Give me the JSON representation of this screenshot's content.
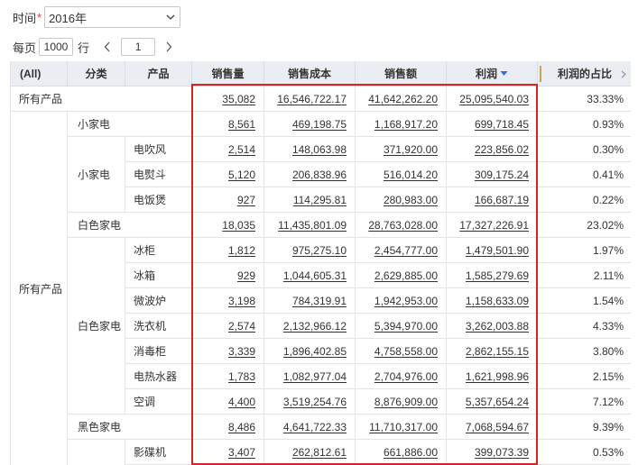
{
  "filter": {
    "label": "时间",
    "required_mark": "*",
    "value": "2016年"
  },
  "pager": {
    "per_page_label": "每页",
    "per_page_value": "1000",
    "per_page_unit": "行",
    "page": "1"
  },
  "columns": {
    "all": "(All)",
    "category": "分类",
    "product": "产品",
    "sales_qty": "销售量",
    "sales_cost": "销售成本",
    "sales_amount": "销售额",
    "profit": "利润",
    "profit_share": "利润的占比"
  },
  "groups": {
    "all_products": "所有产品",
    "small_appliances": "小家电",
    "white_appliances": "白色家电",
    "black_appliances": "黑色家电"
  },
  "rows": [
    {
      "label": "所有产品",
      "qty": "35,082",
      "cost": "16,546,722.17",
      "amount": "41,642,262.20",
      "profit": "25,095,540.03",
      "share": "33.33%"
    },
    {
      "label": "小家电",
      "qty": "8,561",
      "cost": "469,198.75",
      "amount": "1,168,917.20",
      "profit": "699,718.45",
      "share": "0.93%"
    },
    {
      "label": "电吹风",
      "qty": "2,514",
      "cost": "148,063.98",
      "amount": "371,920.00",
      "profit": "223,856.02",
      "share": "0.30%"
    },
    {
      "label": "电熨斗",
      "qty": "5,120",
      "cost": "206,838.96",
      "amount": "516,014.20",
      "profit": "309,175.24",
      "share": "0.41%"
    },
    {
      "label": "电饭煲",
      "qty": "927",
      "cost": "114,295.81",
      "amount": "280,983.00",
      "profit": "166,687.19",
      "share": "0.22%"
    },
    {
      "label": "白色家电",
      "qty": "18,035",
      "cost": "11,435,801.09",
      "amount": "28,763,028.00",
      "profit": "17,327,226.91",
      "share": "23.02%"
    },
    {
      "label": "冰柜",
      "qty": "1,812",
      "cost": "975,275.10",
      "amount": "2,454,777.00",
      "profit": "1,479,501.90",
      "share": "1.97%"
    },
    {
      "label": "冰箱",
      "qty": "929",
      "cost": "1,044,605.31",
      "amount": "2,629,885.00",
      "profit": "1,585,279.69",
      "share": "2.11%"
    },
    {
      "label": "微波炉",
      "qty": "3,198",
      "cost": "784,319.91",
      "amount": "1,942,953.00",
      "profit": "1,158,633.09",
      "share": "1.54%"
    },
    {
      "label": "洗衣机",
      "qty": "2,574",
      "cost": "2,132,966.12",
      "amount": "5,394,970.00",
      "profit": "3,262,003.88",
      "share": "4.33%"
    },
    {
      "label": "消毒柜",
      "qty": "3,339",
      "cost": "1,896,402.85",
      "amount": "4,758,558.00",
      "profit": "2,862,155.15",
      "share": "3.80%"
    },
    {
      "label": "电热水器",
      "qty": "1,783",
      "cost": "1,082,977.04",
      "amount": "2,704,976.00",
      "profit": "1,621,998.96",
      "share": "2.15%"
    },
    {
      "label": "空调",
      "qty": "4,400",
      "cost": "3,519,254.76",
      "amount": "8,876,909.00",
      "profit": "5,357,654.24",
      "share": "7.12%"
    },
    {
      "label": "黑色家电",
      "qty": "8,486",
      "cost": "4,641,722.33",
      "amount": "11,710,317.00",
      "profit": "7,068,594.67",
      "share": "9.39%"
    },
    {
      "label": "影碟机",
      "qty": "3,407",
      "cost": "262,812.61",
      "amount": "661,886.00",
      "profit": "399,073.39",
      "share": "0.53%"
    }
  ],
  "colors": {
    "header_bg": "#eaeef3",
    "highlight_border": "#d62424",
    "sort_icon": "#2f6fd6",
    "grid_line": "#e4e4e4"
  },
  "icons": {
    "dropdown": "chevron-down-icon",
    "prev": "chevron-left-icon",
    "next": "chevron-right-icon",
    "sort": "sort-desc-icon",
    "column_menu": "chevron-right-icon"
  }
}
